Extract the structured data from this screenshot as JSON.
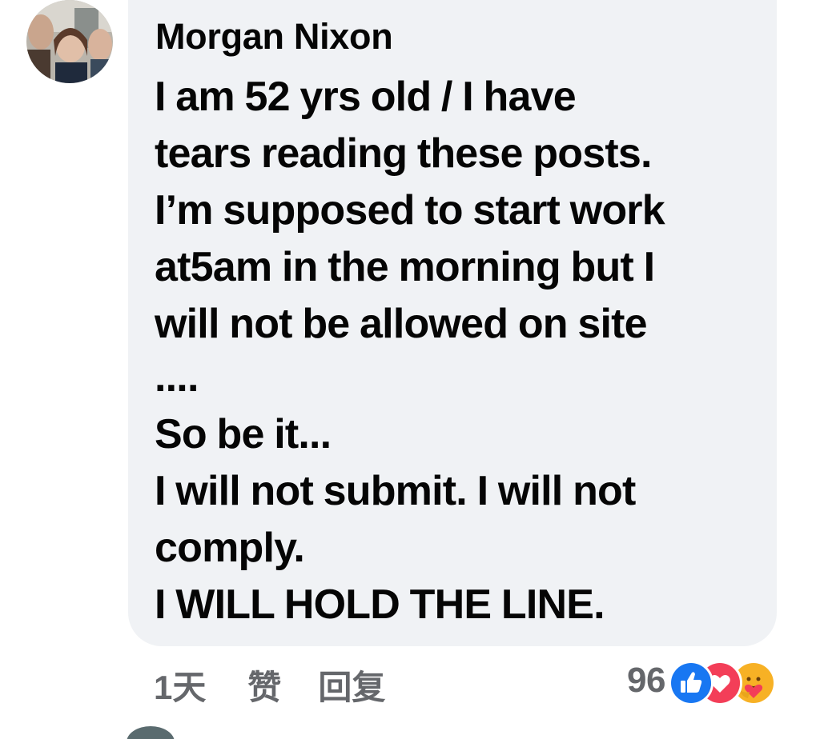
{
  "comment": {
    "author": "Morgan Nixon",
    "text_lines": [
      "I am 52 yrs old / I have",
      "tears reading these posts.",
      "I’m supposed to start work",
      "at5am in the morning but I",
      "will not be allowed on site",
      "....",
      "So be it...",
      "I will not submit. I will not",
      "comply.",
      "I WILL HOLD THE LINE."
    ]
  },
  "actions": {
    "time": "1天",
    "like_label": "赞",
    "reply_label": "回复"
  },
  "reactions": {
    "count": "96",
    "icons": [
      "like-icon",
      "love-icon",
      "care-icon"
    ],
    "colors": {
      "like": "#1877f2",
      "love": "#f33e58",
      "care": "#f7b125"
    }
  },
  "colors": {
    "bubble_bg": "#f0f2f5",
    "text": "#050505",
    "secondary_text": "#65676b"
  }
}
